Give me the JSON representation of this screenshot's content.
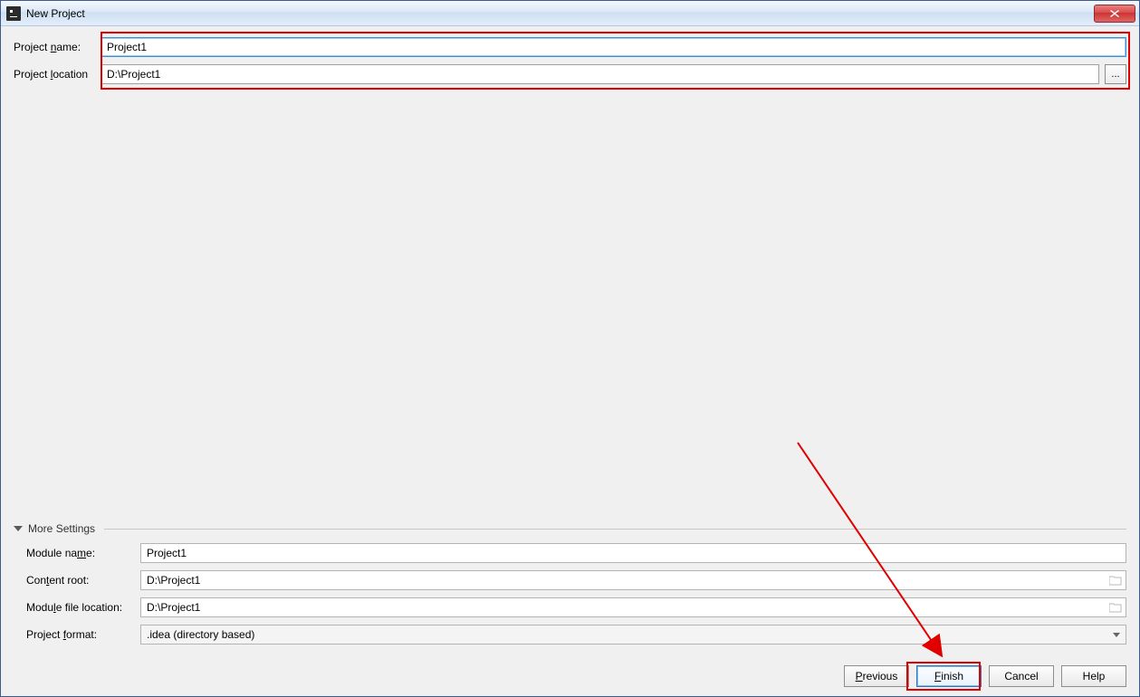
{
  "window": {
    "title": "New Project"
  },
  "fields": {
    "project_name_label": "Project name:",
    "project_name_value": "Project1",
    "project_location_label": "Project location",
    "project_location_value": "D:\\Project1",
    "browse_label": "..."
  },
  "more_settings": {
    "header": "More Settings",
    "module_name_label": "Module name:",
    "module_name_value": "Project1",
    "content_root_label": "Content root:",
    "content_root_value": "D:\\Project1",
    "module_file_location_label": "Module file location:",
    "module_file_location_value": "D:\\Project1",
    "project_format_label": "Project format:",
    "project_format_value": ".idea (directory based)"
  },
  "buttons": {
    "previous": "Previous",
    "finish": "Finish",
    "cancel": "Cancel",
    "help": "Help"
  }
}
